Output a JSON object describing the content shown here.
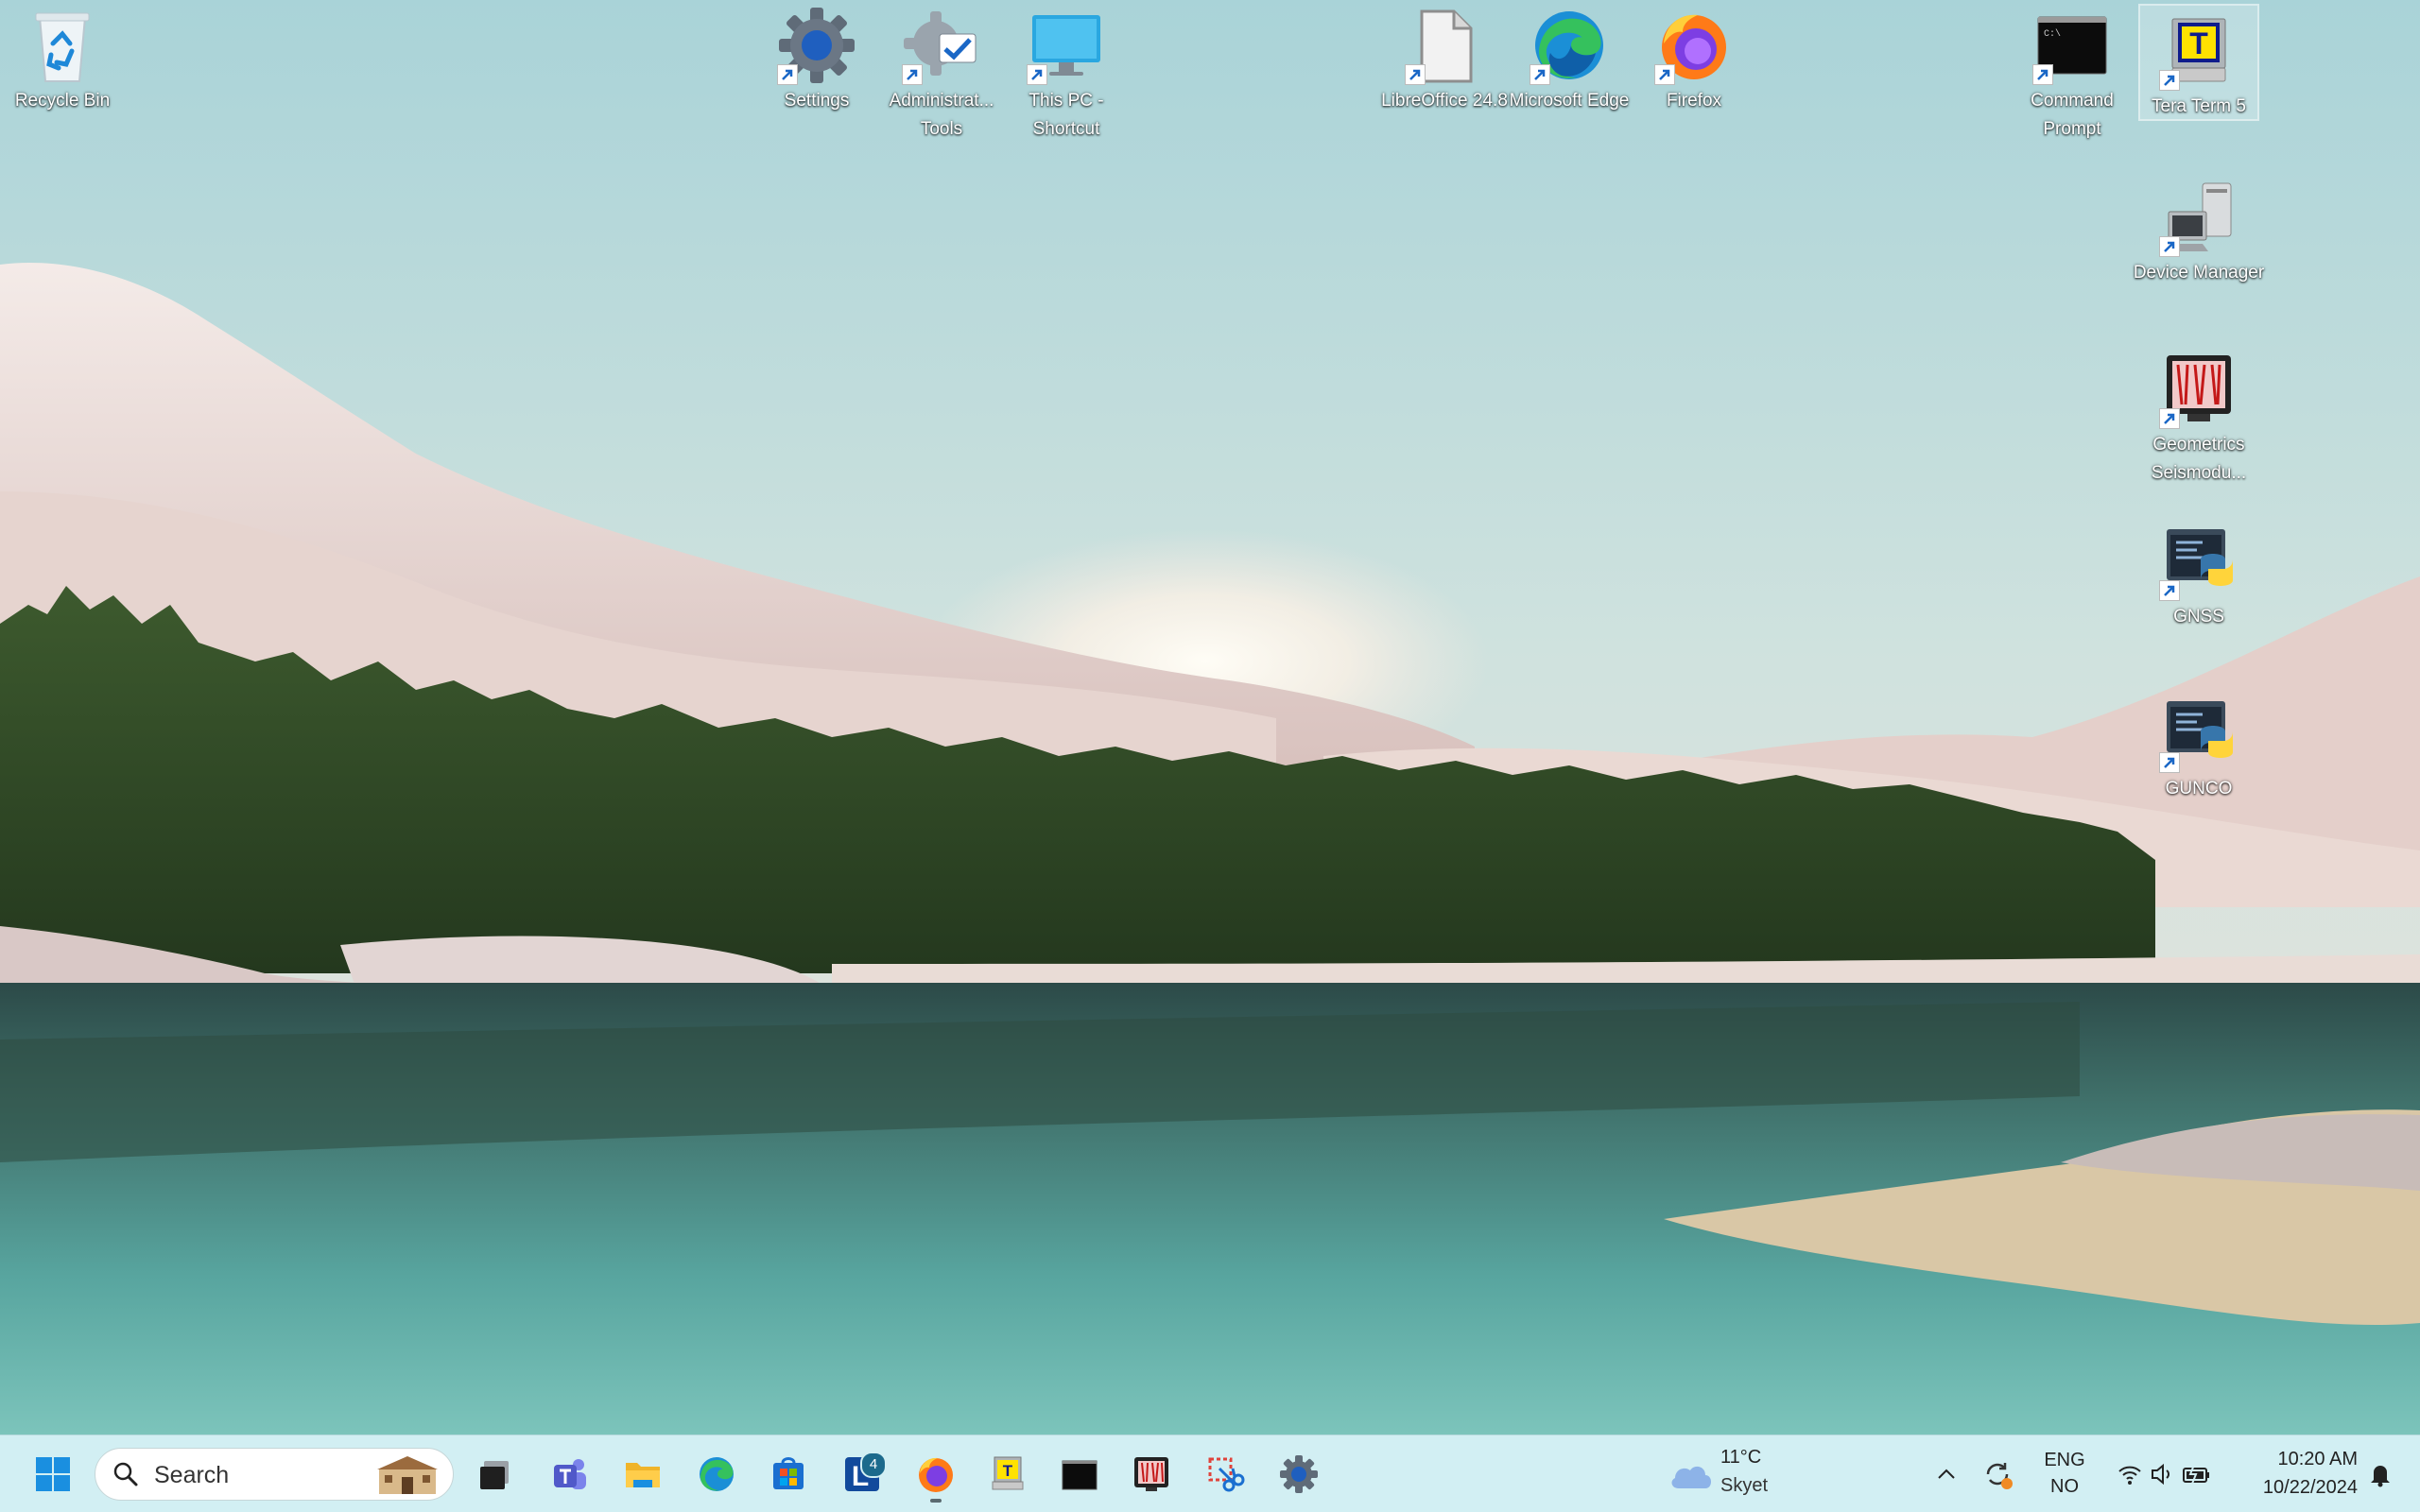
{
  "desktop": {
    "icons": [
      {
        "id": "recycle-bin",
        "label": "Recycle Bin"
      },
      {
        "id": "settings",
        "label": "Settings"
      },
      {
        "id": "admin-tools",
        "label": "Administrat... Tools"
      },
      {
        "id": "this-pc",
        "label": "This PC - Shortcut"
      },
      {
        "id": "libreoffice",
        "label": "LibreOffice 24.8"
      },
      {
        "id": "edge",
        "label": "Microsoft Edge"
      },
      {
        "id": "firefox",
        "label": "Firefox"
      },
      {
        "id": "cmd",
        "label": "Command Prompt"
      },
      {
        "id": "teraterm",
        "label": "Tera Term 5"
      },
      {
        "id": "device-manager",
        "label": "Device Manager"
      },
      {
        "id": "geometrics",
        "label": "Geometrics Seismodu..."
      },
      {
        "id": "gnss",
        "label": "GNSS"
      },
      {
        "id": "gunco",
        "label": "GUNCO"
      }
    ]
  },
  "taskbar": {
    "search_placeholder": "Search",
    "pinned": [
      {
        "id": "start",
        "icon": "windows-logo-icon"
      },
      {
        "id": "task-view",
        "icon": "task-view-icon"
      },
      {
        "id": "teams",
        "icon": "teams-icon"
      },
      {
        "id": "file-explorer",
        "icon": "folder-icon"
      },
      {
        "id": "edge",
        "icon": "edge-icon"
      },
      {
        "id": "store",
        "icon": "store-icon"
      },
      {
        "id": "launcher",
        "icon": "l-app-icon",
        "badge": "4"
      },
      {
        "id": "firefox",
        "icon": "firefox-icon"
      },
      {
        "id": "teraterm",
        "icon": "teraterm-icon"
      },
      {
        "id": "cmd",
        "icon": "terminal-icon"
      },
      {
        "id": "geometrics",
        "icon": "seismograph-icon"
      },
      {
        "id": "snipping",
        "icon": "snipping-tool-icon"
      },
      {
        "id": "settings",
        "icon": "gear-icon"
      }
    ],
    "weather": {
      "temp": "11°C",
      "desc": "Skyet"
    },
    "language": {
      "line1": "ENG",
      "line2": "NO"
    },
    "clock": {
      "time": "10:20 AM",
      "date": "10/22/2024"
    }
  }
}
